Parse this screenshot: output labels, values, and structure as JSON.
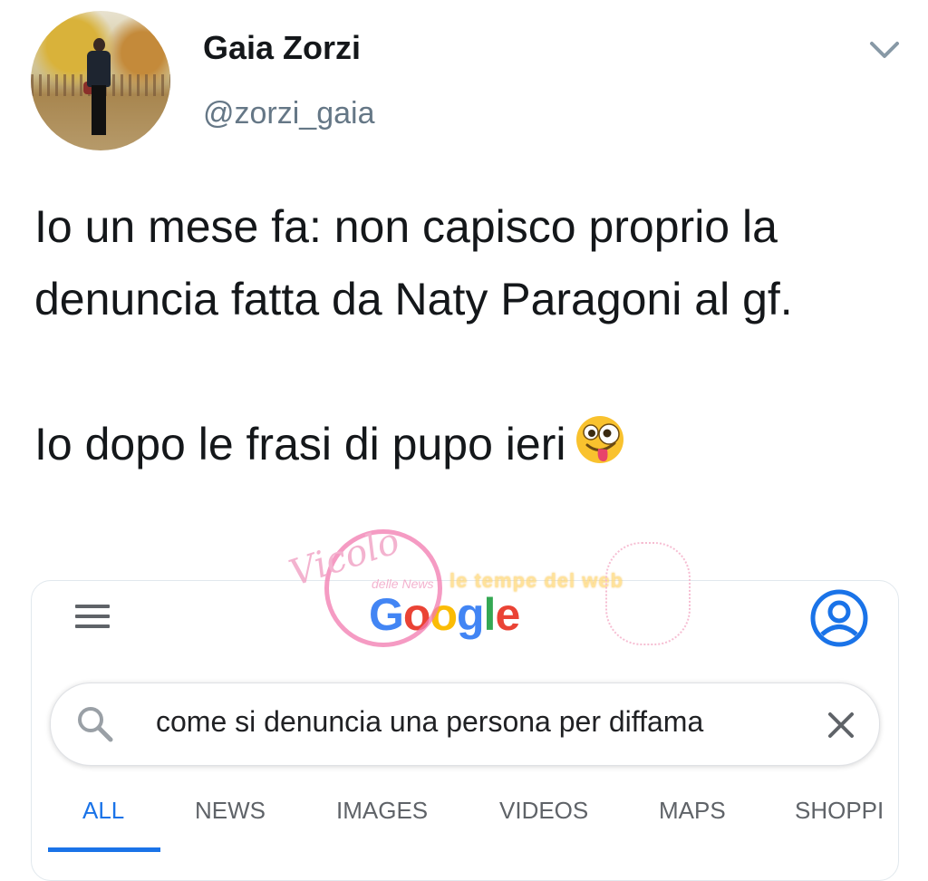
{
  "author": {
    "name": "Gaia Zorzi",
    "handle": "@zorzi_gaia",
    "avatar_icon": "profile-photo"
  },
  "menu_icon": "chevron-down-icon",
  "tweet": {
    "paragraph1": "Io un mese fa: non capisco proprio la denuncia fatta da Naty Paragoni al gf.",
    "paragraph2": "Io dopo le frasi di pupo ieri",
    "emoji": "zany-face-emoji"
  },
  "embed": {
    "logo_text": "Google",
    "search": {
      "query": "come si denuncia una persona per diffama"
    },
    "tabs": [
      {
        "label": "ALL",
        "active": true
      },
      {
        "label": "NEWS",
        "active": false
      },
      {
        "label": "IMAGES",
        "active": false
      },
      {
        "label": "VIDEOS",
        "active": false
      },
      {
        "label": "MAPS",
        "active": false
      },
      {
        "label": "SHOPPI",
        "active": false
      }
    ]
  },
  "watermark": {
    "script_text": "Vicolo",
    "small_text": "delle News",
    "band_text": "le tempe del web"
  },
  "colors": {
    "accent": "#1a73e8",
    "handle_grey": "#657786",
    "text": "#14171a"
  }
}
